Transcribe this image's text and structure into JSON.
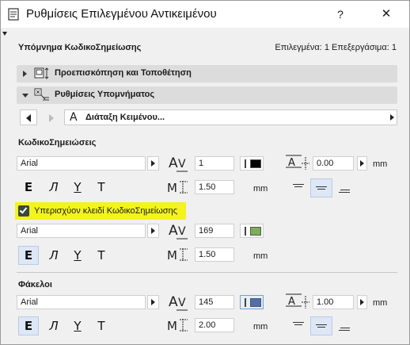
{
  "window": {
    "title": "Ρυθμίσεις Επιλεγμένου Αντικειμένου",
    "help_label": "?",
    "close_label": "✕"
  },
  "header": {
    "left": "Υπόμνημα ΚωδικοΣημείωσης",
    "right": "Επιλεγμένα: 1 Επεξεργάσιμα: 1"
  },
  "panels": [
    {
      "label": "Προεπισκόπηση και Τοποθέτηση",
      "expanded": false,
      "icon": "preview-placement-icon"
    },
    {
      "label": "Ρυθμίσεις Υπομνήματος",
      "expanded": true,
      "icon": "label-settings-icon"
    }
  ],
  "page_selector": {
    "label": "Διάταξη Κειμένου...",
    "icon": "text-layout-icon"
  },
  "sections": {
    "keynotes": {
      "title": "ΚωδικοΣημειώσεις",
      "font": "Arial",
      "pen": "1",
      "pen_color": "#000000",
      "size": "1.50",
      "size_unit": "mm",
      "leading": "0.00",
      "leading_unit": "mm",
      "style_active": "bold",
      "align_active": "center"
    },
    "override": {
      "label": "Υπερισχύον κλειδί ΚωδικοΣημείωσης",
      "checked": true,
      "font": "Arial",
      "pen": "169",
      "pen_color": "#7fae5a",
      "size": "1.50",
      "size_unit": "mm",
      "style_active": "bold"
    },
    "folders": {
      "title": "Φάκελοι",
      "font": "Arial",
      "pen": "145",
      "pen_color": "#4f6fb0",
      "size": "2.00",
      "size_unit": "mm",
      "leading": "1.00",
      "leading_unit": "mm",
      "style_active": "bold",
      "align_active": "center"
    }
  },
  "style_glyphs": {
    "bold": "E",
    "italic": "Л",
    "underline": "Y",
    "strike": "T"
  },
  "icons": {
    "size": "size-icon",
    "height": "text-height-icon",
    "leading": "leading-icon"
  }
}
